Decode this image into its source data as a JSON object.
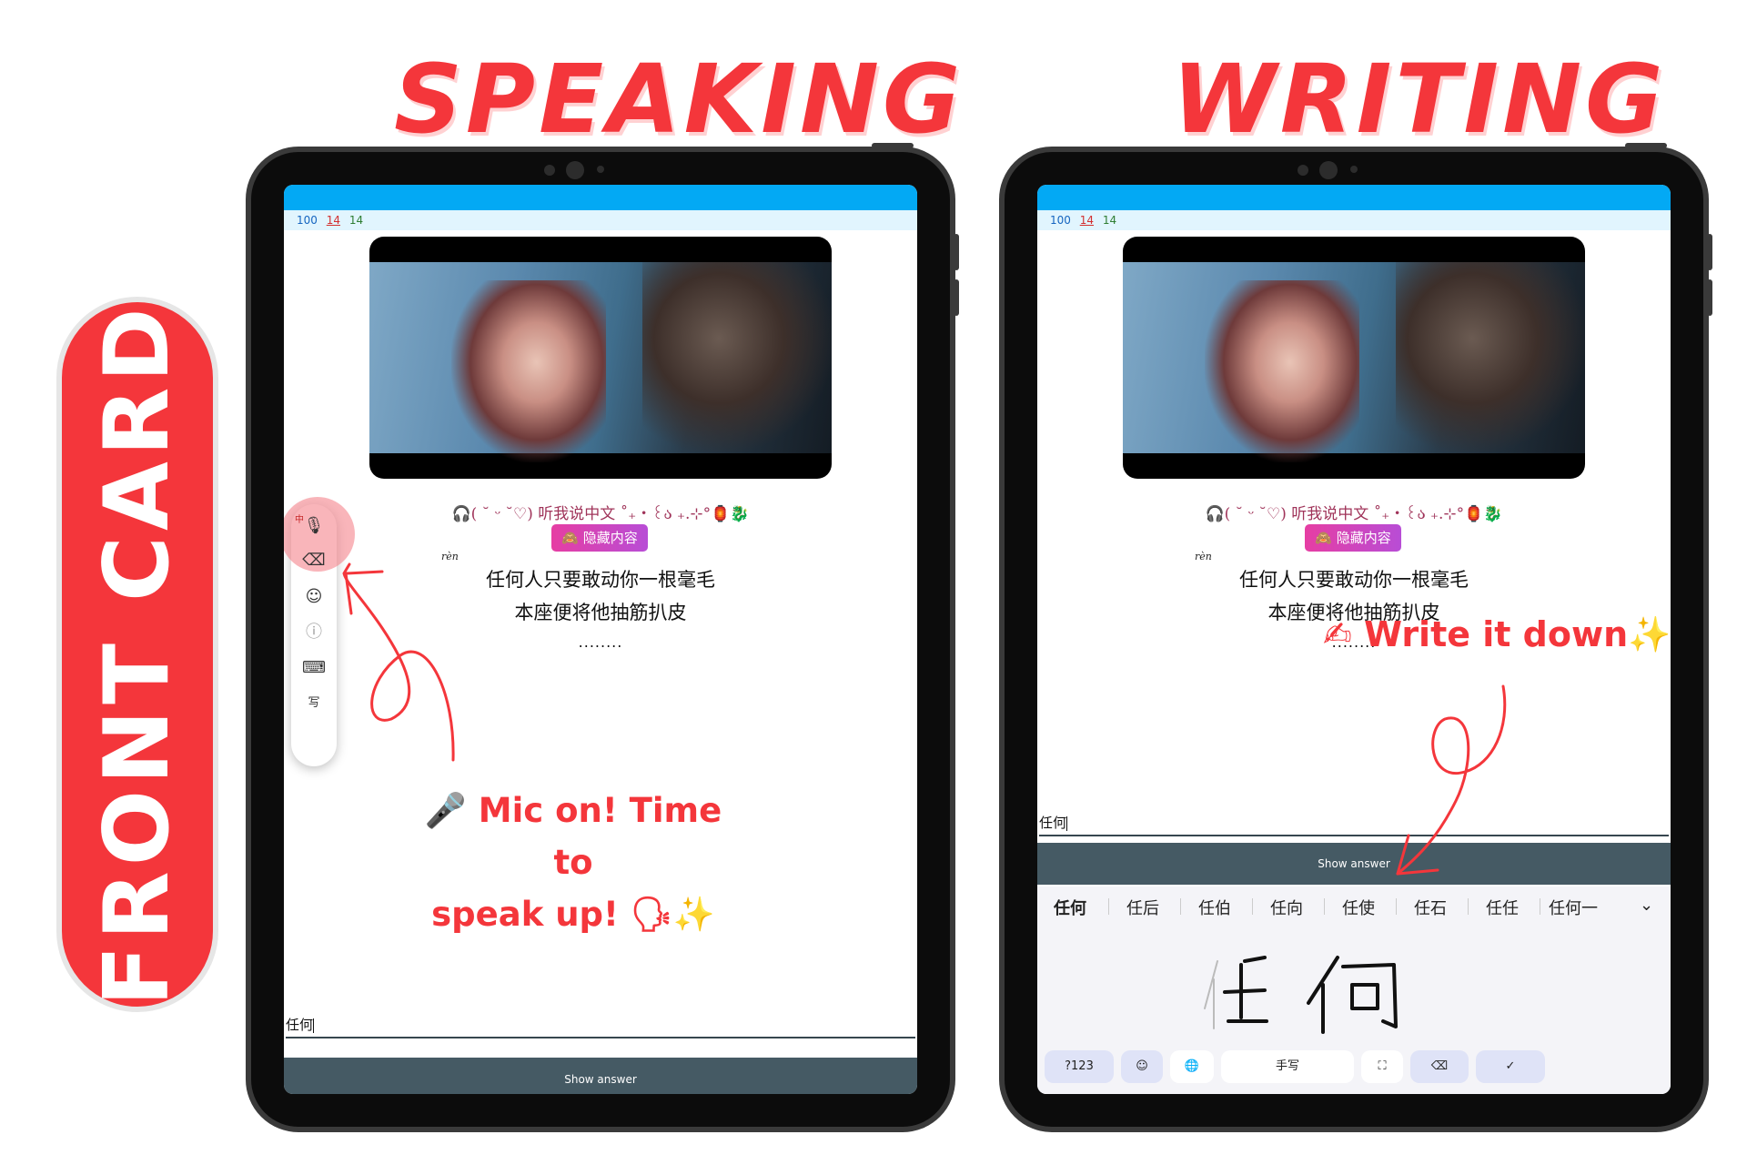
{
  "headings": {
    "left": "SPEAKING",
    "right": "WRITING"
  },
  "side_label": "FRONT CARD",
  "card": {
    "counts": {
      "new": "100",
      "learning": "14",
      "review": "14"
    },
    "prompt": "🎧( ˘ ᵕ ˘♡) 听我说中文 ˚₊‧꒰ა ₊.⊹°🏮🐉",
    "hidden_button": "🙈 隐藏内容",
    "ruby": "rèn",
    "line1": "任何人只要敢动你一根毫毛",
    "line2": "本座便将他抽筋扒皮",
    "dots": "........",
    "answer_value": "任何",
    "show_answer": "Show answer"
  },
  "speaking_toolbar": {
    "lang": "中",
    "mic_icon": "🎙",
    "backspace_icon": "⌫",
    "emoji_icon": "☺",
    "info_icon": "ⓘ",
    "keyboard_icon": "⌨",
    "handwrite_icon": "写"
  },
  "candidates": [
    "任何",
    "任后",
    "任伯",
    "任向",
    "任使",
    "任石",
    "任任",
    "任何一"
  ],
  "expand_icon": "⌄",
  "handwriting": {
    "strokes": "任 何"
  },
  "keyboard": {
    "numbers": "?123",
    "emoji": "☺",
    "globe": "🌐",
    "mode": "手写",
    "fullscreen": "⛶",
    "delete": "⌫",
    "enter": "✓"
  },
  "notes": {
    "speak_line1": "🎤 Mic on! Time to",
    "speak_line2": "speak up! 🗣✨",
    "write": "✍ Write it down✨"
  },
  "colors": {
    "accent_red": "#f4363b",
    "status_bar": "#03a9f4",
    "show_answer_bar": "#455a64"
  }
}
